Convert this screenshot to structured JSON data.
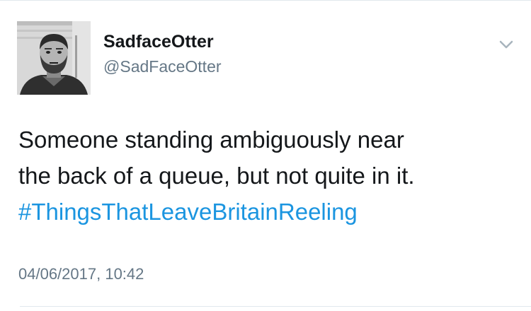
{
  "tweet": {
    "display_name": "SadfaceOtter",
    "handle": "@SadFaceOtter",
    "text_lines": [
      "Someone standing ambiguously near",
      "the back of a queue, but not quite in it."
    ],
    "hashtag": "#ThingsThatLeaveBritainReeling",
    "timestamp": "04/06/2017, 10:42",
    "avatar_icon": "user-photo",
    "menu_icon": "chevron-down-icon"
  },
  "colors": {
    "text": "#14171a",
    "secondary": "#657786",
    "link": "#1b95e0",
    "divider": "#e1e8ed"
  }
}
